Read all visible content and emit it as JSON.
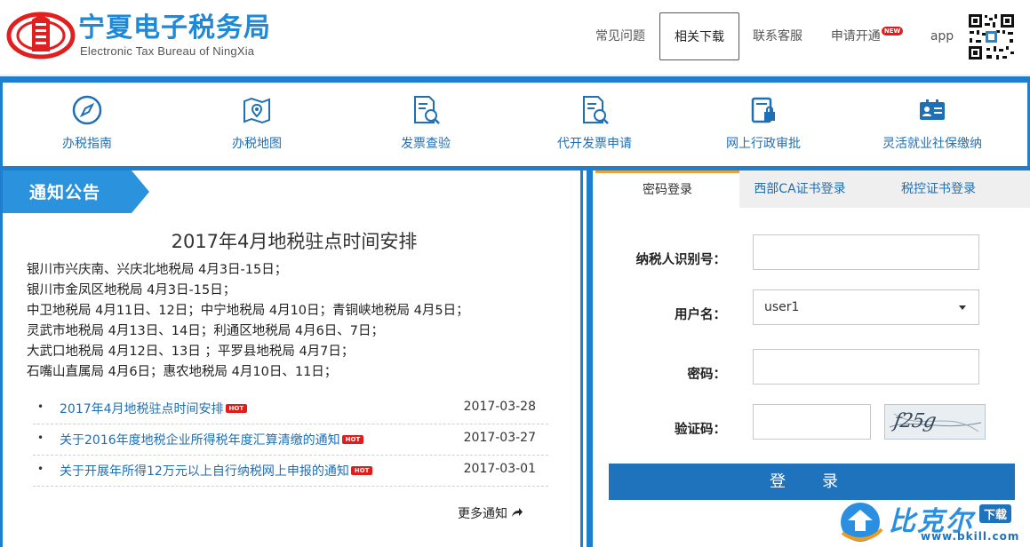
{
  "header": {
    "title": "宁夏电子税务局",
    "subtitle": "Electronic Tax Bureau of NingXia",
    "nav": [
      {
        "label": "常见问题"
      },
      {
        "label": "相关下载"
      },
      {
        "label": "联系客服"
      },
      {
        "label": "申请开通",
        "badge": "NEW"
      },
      {
        "label": "app"
      }
    ],
    "qr_icon": "qr-code",
    "brand_color": "#1e88d9",
    "accent_red": "#e21b1b"
  },
  "services": [
    {
      "label": "办税指南",
      "icon": "compass-icon"
    },
    {
      "label": "办税地图",
      "icon": "map-pin-icon"
    },
    {
      "label": "发票查验",
      "icon": "invoice-search-icon"
    },
    {
      "label": "代开发票申请",
      "icon": "invoice-apply-icon"
    },
    {
      "label": "网上行政审批",
      "icon": "approval-lock-icon"
    },
    {
      "label": "灵活就业社保缴纳",
      "icon": "id-card-icon"
    }
  ],
  "notice": {
    "tag": "通知公告",
    "title": "2017年4月地税驻点时间安排",
    "lines": [
      "银川市兴庆南、兴庆北地税局 4月3日-15日；",
      "银川市金凤区地税局 4月3日-15日；",
      "中卫地税局 4月11日、12日；中宁地税局 4月10日；青铜峡地税局 4月5日；",
      "灵武市地税局 4月13日、14日；利通区地税局 4月6日、7日；",
      "大武口地税局 4月12日、13日 ；平罗县地税局 4月7日；",
      "石嘴山直属局 4月6日；惠农地税局 4月10日、11日；"
    ],
    "news": [
      {
        "text": "2017年4月地税驻点时间安排",
        "badge": "HOT",
        "date": "2017-03-28"
      },
      {
        "text": "关于2016年度地税企业所得税年度汇算清缴的通知",
        "badge": "HOT",
        "date": "2017-03-27"
      },
      {
        "text": "关于开展年所得12万元以上自行纳税网上申报的通知",
        "badge": "HOT",
        "date": "2017-03-01"
      }
    ],
    "more": "更多通知"
  },
  "login": {
    "tabs": [
      "密码登录",
      "西部CA证书登录",
      "税控证书登录"
    ],
    "taxpayer_id_label": "纳税人识别号：",
    "taxpayer_id_value": "",
    "username_label": "用户名：",
    "username_value": "user1",
    "password_label": "密码：",
    "password_value": "",
    "captcha_label": "验证码：",
    "captcha_value": "",
    "captcha_image_text": "f25g",
    "submit_label": "登 录"
  },
  "watermark": {
    "text": "比克尔",
    "badge": "下载",
    "url": "www.bkill.com"
  }
}
